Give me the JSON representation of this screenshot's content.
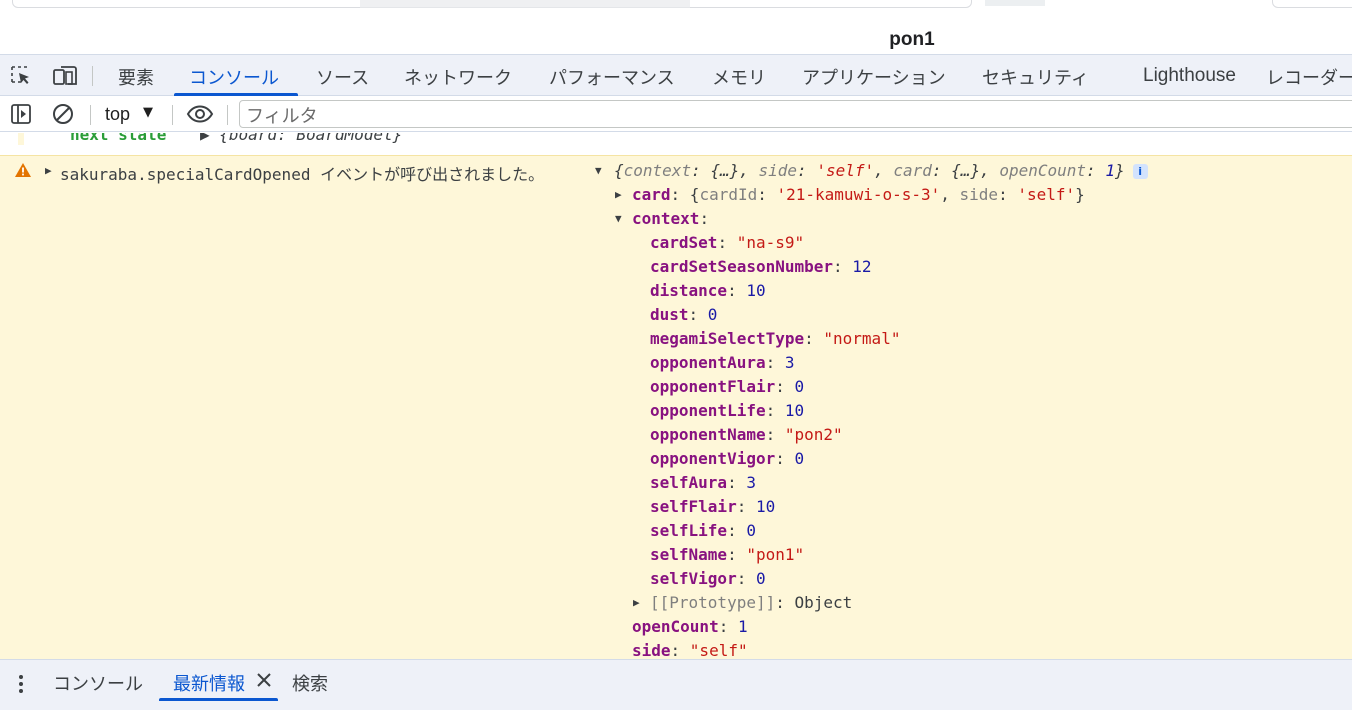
{
  "page": {
    "title": "pon1"
  },
  "tabs": [
    {
      "label": "要素"
    },
    {
      "label": "コンソール"
    },
    {
      "label": "ソース"
    },
    {
      "label": "ネットワーク"
    },
    {
      "label": "パフォーマンス"
    },
    {
      "label": "メモリ"
    },
    {
      "label": "アプリケーション"
    },
    {
      "label": "セキュリティ"
    },
    {
      "label": "Lighthouse"
    },
    {
      "label": "レコーダー"
    }
  ],
  "active_tab": "コンソール",
  "toolbar": {
    "context": "top",
    "filter_placeholder": "フィルタ"
  },
  "console": {
    "prev_key": "next state",
    "prev_value": "{board: BoardModel}",
    "warning": {
      "source": "sakuraba.specialCardOpened",
      "message": "イベントが呼び出されました。",
      "summary": {
        "open": "{",
        "k1": "context",
        "v1": "{…}",
        "k2": "side",
        "v2": "'self'",
        "k3": "card",
        "v3": "{…}",
        "k4": "openCount",
        "v4": "1",
        "close": "}"
      },
      "card": {
        "key": "card",
        "open": "{",
        "k1": "cardId",
        "v1": "'21-kamuwi-o-s-3'",
        "k2": "side",
        "v2": "'self'",
        "close": "}"
      },
      "context_key": "context",
      "context_props": [
        {
          "key": "cardSet",
          "value": "\"na-s9\"",
          "type": "str"
        },
        {
          "key": "cardSetSeasonNumber",
          "value": "12",
          "type": "num"
        },
        {
          "key": "distance",
          "value": "10",
          "type": "num"
        },
        {
          "key": "dust",
          "value": "0",
          "type": "num"
        },
        {
          "key": "megamiSelectType",
          "value": "\"normal\"",
          "type": "str"
        },
        {
          "key": "opponentAura",
          "value": "3",
          "type": "num"
        },
        {
          "key": "opponentFlair",
          "value": "0",
          "type": "num"
        },
        {
          "key": "opponentLife",
          "value": "10",
          "type": "num"
        },
        {
          "key": "opponentName",
          "value": "\"pon2\"",
          "type": "str"
        },
        {
          "key": "opponentVigor",
          "value": "0",
          "type": "num"
        },
        {
          "key": "selfAura",
          "value": "3",
          "type": "num"
        },
        {
          "key": "selfFlair",
          "value": "10",
          "type": "num"
        },
        {
          "key": "selfLife",
          "value": "0",
          "type": "num"
        },
        {
          "key": "selfName",
          "value": "\"pon1\"",
          "type": "str"
        },
        {
          "key": "selfVigor",
          "value": "0",
          "type": "num"
        }
      ],
      "prototype": {
        "key": "[[Prototype]]",
        "value": "Object"
      },
      "open_count": {
        "key": "openCount",
        "value": "1"
      },
      "side": {
        "key": "side",
        "value": "\"self\""
      }
    }
  },
  "drawer": {
    "tabs": [
      {
        "label": "コンソール"
      },
      {
        "label": "最新情報"
      },
      {
        "label": "検索"
      }
    ],
    "active": "最新情報"
  },
  "colors": {
    "accent": "#0b57d0",
    "warning_bg": "#fef7d9",
    "warning_icon": "#e37400",
    "key": "#881280",
    "string": "#c41a16",
    "number": "#1a1aa6"
  },
  "icons": [
    "inspect-element-icon",
    "device-toolbar-icon",
    "sidebar-toggle-icon",
    "clear-console-icon",
    "eye-icon",
    "warning-icon",
    "expand-triangle-icon",
    "collapse-triangle-icon",
    "info-icon",
    "more-vert-icon",
    "close-icon"
  ]
}
